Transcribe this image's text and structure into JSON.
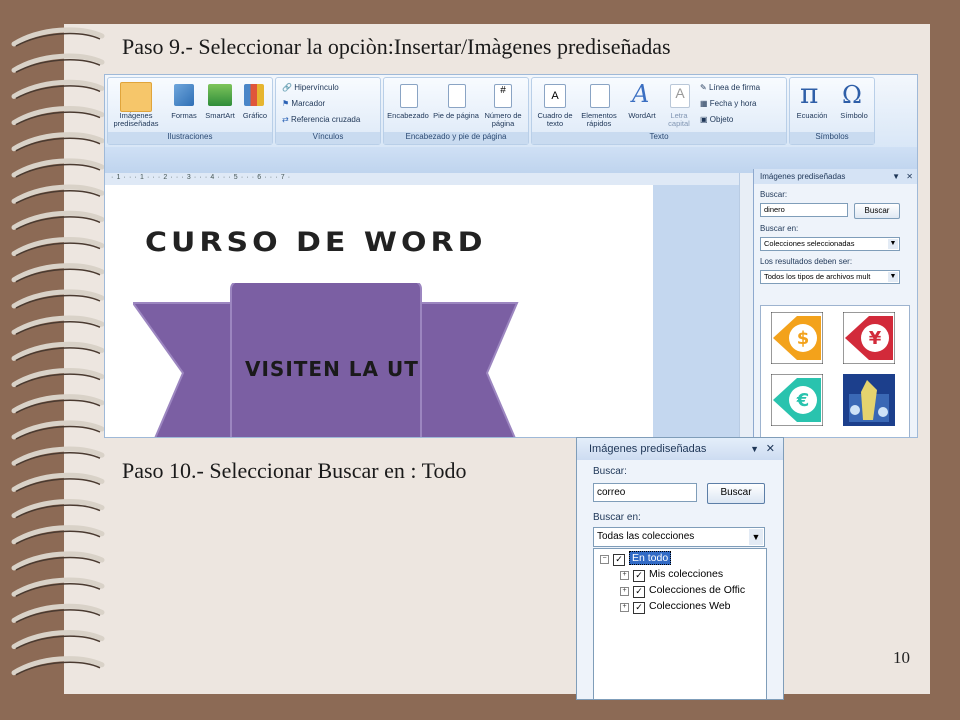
{
  "slide": {
    "title_step9": "Paso 9.- Seleccionar la opciòn:Insertar/Imàgenes prediseñadas",
    "title_step10": "Paso 10.- Seleccionar Buscar en : Todo",
    "page_number": "10"
  },
  "ribbon": {
    "groups": [
      {
        "label": "Ilustraciones",
        "items": [
          "Imágenes prediseñadas",
          "Formas",
          "SmartArt",
          "Gráfico"
        ]
      },
      {
        "label": "Vínculos",
        "items": [
          "Hipervínculo",
          "Marcador",
          "Referencia cruzada"
        ]
      },
      {
        "label": "Encabezado y pie de página",
        "items": [
          "Encabezado",
          "Pie de página",
          "Número de página"
        ]
      },
      {
        "label": "Texto",
        "items": [
          "Cuadro de texto",
          "Elementos rápidos",
          "WordArt",
          "Letra capital",
          "Línea de firma",
          "Fecha y hora",
          "Objeto"
        ]
      },
      {
        "label": "Símbolos",
        "items": [
          "Ecuación",
          "Símbolo"
        ]
      }
    ]
  },
  "document": {
    "heading": "CURSO DE WORD",
    "banner_text": "VISITEN LA UT",
    "ruler": "· 1 · · · 1 · · · 2 · · · 3 · · · 4 · · · 5 · · · 6 · · · 7 ·"
  },
  "pane1": {
    "header": "Imágenes prediseñadas",
    "search_label": "Buscar:",
    "search_value": "dinero",
    "search_button": "Buscar",
    "search_in_label": "Buscar en:",
    "search_in_value": "Colecciones seleccionadas",
    "results_label": "Los resultados deben ser:",
    "results_value": "Todos los tipos de archivos mult"
  },
  "pane2": {
    "header": "Imágenes prediseñadas",
    "search_label": "Buscar:",
    "search_value": "correo",
    "search_button": "Buscar",
    "search_in_label": "Buscar en:",
    "search_in_value": "Todas las colecciones",
    "tree": [
      "En todo",
      "Mis colecciones",
      "Colecciones de Offic",
      "Colecciones Web"
    ]
  },
  "colors": {
    "purple": "#7b5fa3",
    "clip_orange": "#f3a21b",
    "clip_red": "#d22a3a",
    "clip_teal": "#29c3ae"
  }
}
